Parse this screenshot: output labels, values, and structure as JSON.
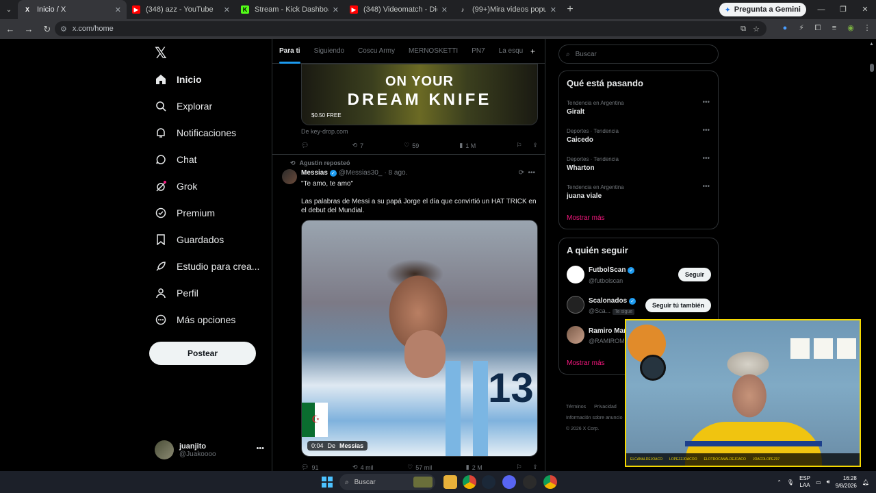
{
  "browser": {
    "tabs": [
      {
        "label": "Inicio / X",
        "icon": "x-logo-icon",
        "color": "#ffffff",
        "active": true
      },
      {
        "label": "(348) azz - YouTube",
        "icon": "youtube-icon",
        "color": "#ff0000"
      },
      {
        "label": "Stream - Kick Dashboard",
        "icon": "kick-icon",
        "color": "#53fc18"
      },
      {
        "label": "(348) Videomatch - Diego (Pan",
        "icon": "youtube-icon",
        "color": "#ff0000"
      },
      {
        "label": "(99+)Mira videos populares sob",
        "icon": "tiktok-icon",
        "color": "#ffffff"
      }
    ],
    "gemini_label": "Pregunta a Gemini",
    "url": "x.com/home"
  },
  "nav": {
    "items": [
      {
        "label": "Inicio",
        "icon": "home-icon",
        "bold": true
      },
      {
        "label": "Explorar",
        "icon": "search-icon"
      },
      {
        "label": "Notificaciones",
        "icon": "bell-icon"
      },
      {
        "label": "Chat",
        "icon": "chat-icon"
      },
      {
        "label": "Grok",
        "icon": "grok-icon"
      },
      {
        "label": "Premium",
        "icon": "premium-icon"
      },
      {
        "label": "Guardados",
        "icon": "bookmark-icon"
      },
      {
        "label": "Estudio para crea...",
        "icon": "rocket-icon"
      },
      {
        "label": "Perfil",
        "icon": "person-icon"
      },
      {
        "label": "Más opciones",
        "icon": "more-circle-icon"
      }
    ],
    "post_button": "Postear",
    "account": {
      "name": "juanjito",
      "handle": "@Juakoooo"
    }
  },
  "feed": {
    "tabs": [
      "Para ti",
      "Siguiendo",
      "Coscu Army",
      "MERNOSKETTI",
      "PN7",
      "La esqu"
    ],
    "ad": {
      "line1": "ON YOUR",
      "line2": "DREAM KNIFE",
      "price": "$0.50 FREE",
      "source": "De key-drop.com",
      "stats": {
        "replies": "",
        "reposts": "7",
        "likes": "59",
        "views": "1 M"
      }
    },
    "tweet": {
      "reposted_by": "Agustin reposteó",
      "author": "Messias",
      "handle": "@Messias30_",
      "date": "· 8 ago.",
      "text1": "\"Te amo, te amo\"",
      "text2": "Las palabras de Messi a su papá Jorge el día que convirtió un HAT TRICK en el debut del Mundial.",
      "video_time": "0:04",
      "video_from": "De",
      "video_source": "Messias",
      "jersey_number": "13",
      "stats": {
        "replies": "91",
        "reposts": "4 mil",
        "likes": "57 mil",
        "views": "2 M"
      }
    }
  },
  "sidebar": {
    "search_placeholder": "Buscar",
    "trends_title": "Qué está pasando",
    "trends": [
      {
        "meta": "Tendencia en Argentina",
        "name": "Giralt"
      },
      {
        "meta": "Deportes · Tendencia",
        "name": "Caicedo"
      },
      {
        "meta": "Deportes · Tendencia",
        "name": "Wharton"
      },
      {
        "meta": "Tendencia en Argentina",
        "name": "juana viale"
      }
    ],
    "show_more": "Mostrar más",
    "follow_title": "A quién seguir",
    "follow": [
      {
        "name": "FutbolScan",
        "handle": "@futbolscan",
        "button": "Seguir"
      },
      {
        "name": "Scalonados",
        "handle": "@Sca...",
        "badge": "Te sigue",
        "button": "Seguir tú también"
      },
      {
        "name": "Ramiro Mar",
        "handle": "@RAMIROM"
      }
    ],
    "footer": [
      "Términos",
      "Privacidad",
      "Información sobre anuncio",
      "© 2026 X Corp."
    ]
  },
  "webcam": {
    "socials": [
      "ELCANALDEJOACO",
      "LOPEZZJOACOO",
      "ELOTROCANALDEJOACO",
      "JOACOLOPEZ97"
    ]
  },
  "taskbar": {
    "search_label": "Buscar",
    "lang_top": "ESP",
    "lang_bottom": "LAA",
    "time": "16:28",
    "date": "9/8/2026"
  }
}
